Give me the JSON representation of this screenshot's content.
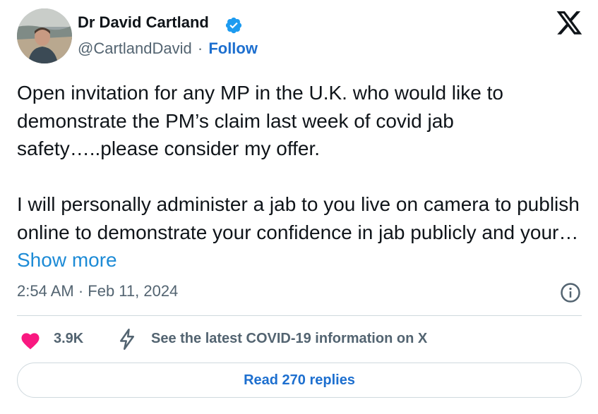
{
  "author": {
    "name": "Dr David Cartland",
    "handle": "@CartlandDavid",
    "separator": "·",
    "follow_label": "Follow",
    "verified": true
  },
  "tweet": {
    "paragraph1": "Open invitation for any MP in the U.K. who would like to demonstrate the PM’s claim last week of covid jab safety…..please consider my offer.",
    "paragraph2": "I will personally administer a jab to you live on camera to publish online to demonstrate your confidence in jab publicly and your…",
    "show_more_label": "Show more",
    "timestamp": "2:54 AM · Feb 11, 2024"
  },
  "actions": {
    "like_count": "3.9K",
    "covid_info_label": "See the latest COVID-19 information on X",
    "read_replies_label": "Read 270 replies"
  },
  "icons": {
    "verified": "verified-badge-icon",
    "platform": "x-logo-icon",
    "info": "info-icon",
    "like": "heart-icon",
    "covid": "lightning-bolt-icon"
  },
  "colors": {
    "text": "#0f1419",
    "secondary_text": "#536471",
    "link": "#1d6fcf",
    "verified_badge": "#1d9bf0",
    "heart": "#f91880",
    "divider": "#cfd9de"
  }
}
